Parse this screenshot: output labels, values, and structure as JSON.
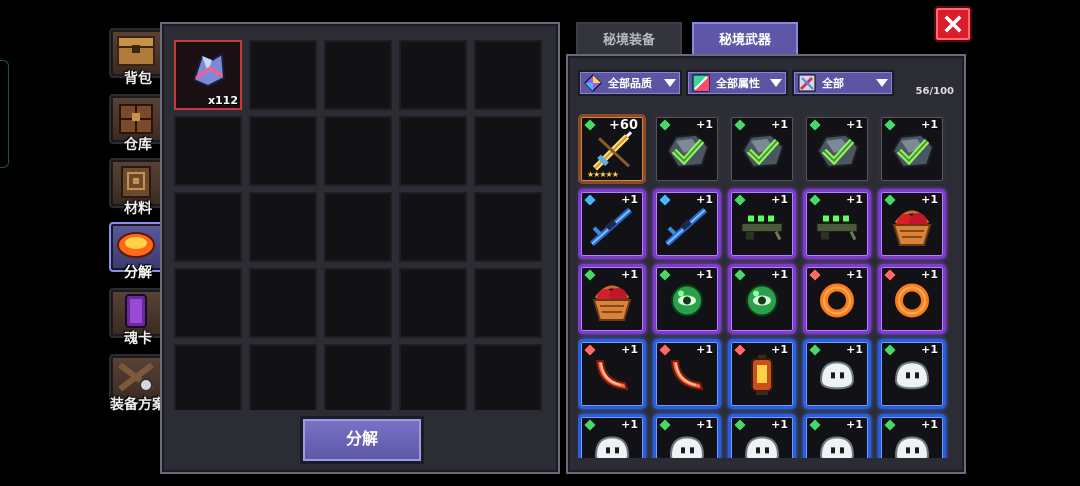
{
  "nav": [
    {
      "name": "backpack",
      "label": "背包",
      "color": "#7a5a38",
      "active": false
    },
    {
      "name": "warehouse",
      "label": "仓库",
      "color": "#5a3a2a",
      "active": false
    },
    {
      "name": "materials",
      "label": "材料",
      "color": "#4a3424",
      "active": false
    },
    {
      "name": "decompose",
      "label": "分解",
      "color": "#e0561c",
      "active": true
    },
    {
      "name": "soul-card",
      "label": "魂卡",
      "color": "#5a2a7a",
      "active": false
    },
    {
      "name": "equip-plan",
      "label": "装备方案",
      "color": "#5a4434",
      "active": false
    }
  ],
  "left_panel": {
    "selected_item": {
      "icon": "crystal-cluster-icon",
      "count": "x112"
    },
    "button_label": "分解"
  },
  "tabs": [
    {
      "label": "秘境装备",
      "active": false
    },
    {
      "label": "秘境武器",
      "active": true
    }
  ],
  "filters": [
    {
      "label": "全部品质",
      "icon": "rainbow-gem-icon"
    },
    {
      "label": "全部属性",
      "icon": "element-square-icon"
    },
    {
      "label": "全部",
      "icon": "swords-icon"
    }
  ],
  "capacity": "56/100",
  "rarity_colors": {
    "gold": "#d08a3a",
    "grey": "#55555f",
    "purple": "#8f4ad8",
    "blue": "#3a6ef0"
  },
  "items": [
    {
      "icon": "golden-sword-icon",
      "rarity": "gold",
      "level": "+60",
      "stars": "★★★★★",
      "gem": "#49d66a"
    },
    {
      "icon": "checked-ore-icon",
      "rarity": "grey",
      "level": "+1",
      "gem": "#49d66a"
    },
    {
      "icon": "checked-ore-icon",
      "rarity": "grey",
      "level": "+1",
      "gem": "#49d66a"
    },
    {
      "icon": "checked-ore-icon",
      "rarity": "grey",
      "level": "+1",
      "gem": "#49d66a"
    },
    {
      "icon": "checked-ore-icon",
      "rarity": "grey",
      "level": "+1",
      "gem": "#49d66a"
    },
    {
      "icon": "blue-rifle-icon",
      "rarity": "purple",
      "level": "+1",
      "gem": "#4ab6ff"
    },
    {
      "icon": "blue-rifle-icon",
      "rarity": "purple",
      "level": "+1",
      "gem": "#4ab6ff"
    },
    {
      "icon": "green-launcher-icon",
      "rarity": "purple",
      "level": "+1",
      "gem": "#49d66a"
    },
    {
      "icon": "green-launcher-icon",
      "rarity": "purple",
      "level": "+1",
      "gem": "#49d66a"
    },
    {
      "icon": "fruit-basket-icon",
      "rarity": "purple",
      "level": "+1",
      "gem": "#49d66a"
    },
    {
      "icon": "fruit-basket-icon",
      "rarity": "purple",
      "level": "+1",
      "gem": "#49d66a"
    },
    {
      "icon": "green-eye-orb-icon",
      "rarity": "purple",
      "level": "+1",
      "gem": "#49d66a"
    },
    {
      "icon": "green-eye-orb-icon",
      "rarity": "purple",
      "level": "+1",
      "gem": "#49d66a"
    },
    {
      "icon": "orange-ring-icon",
      "rarity": "purple",
      "level": "+1",
      "gem": "#ff6b6b"
    },
    {
      "icon": "orange-ring-icon",
      "rarity": "purple",
      "level": "+1",
      "gem": "#ff6b6b"
    },
    {
      "icon": "boomerang-icon",
      "rarity": "blue",
      "level": "+1",
      "gem": "#ff6b6b"
    },
    {
      "icon": "boomerang-icon",
      "rarity": "blue",
      "level": "+1",
      "gem": "#ff6b6b"
    },
    {
      "icon": "lantern-icon",
      "rarity": "blue",
      "level": "+1",
      "gem": "#ff6b6b"
    },
    {
      "icon": "white-blob-icon",
      "rarity": "blue",
      "level": "+1",
      "gem": "#49d66a"
    },
    {
      "icon": "white-blob-icon",
      "rarity": "blue",
      "level": "+1",
      "gem": "#49d66a"
    },
    {
      "icon": "white-blob-icon",
      "rarity": "blue",
      "level": "+1",
      "gem": "#49d66a"
    },
    {
      "icon": "white-blob-icon",
      "rarity": "blue",
      "level": "+1",
      "gem": "#49d66a"
    },
    {
      "icon": "white-blob-icon",
      "rarity": "blue",
      "level": "+1",
      "gem": "#49d66a"
    },
    {
      "icon": "white-blob-icon",
      "rarity": "blue",
      "level": "+1",
      "gem": "#49d66a"
    },
    {
      "icon": "white-blob-icon",
      "rarity": "blue",
      "level": "+1",
      "gem": "#49d66a"
    }
  ]
}
